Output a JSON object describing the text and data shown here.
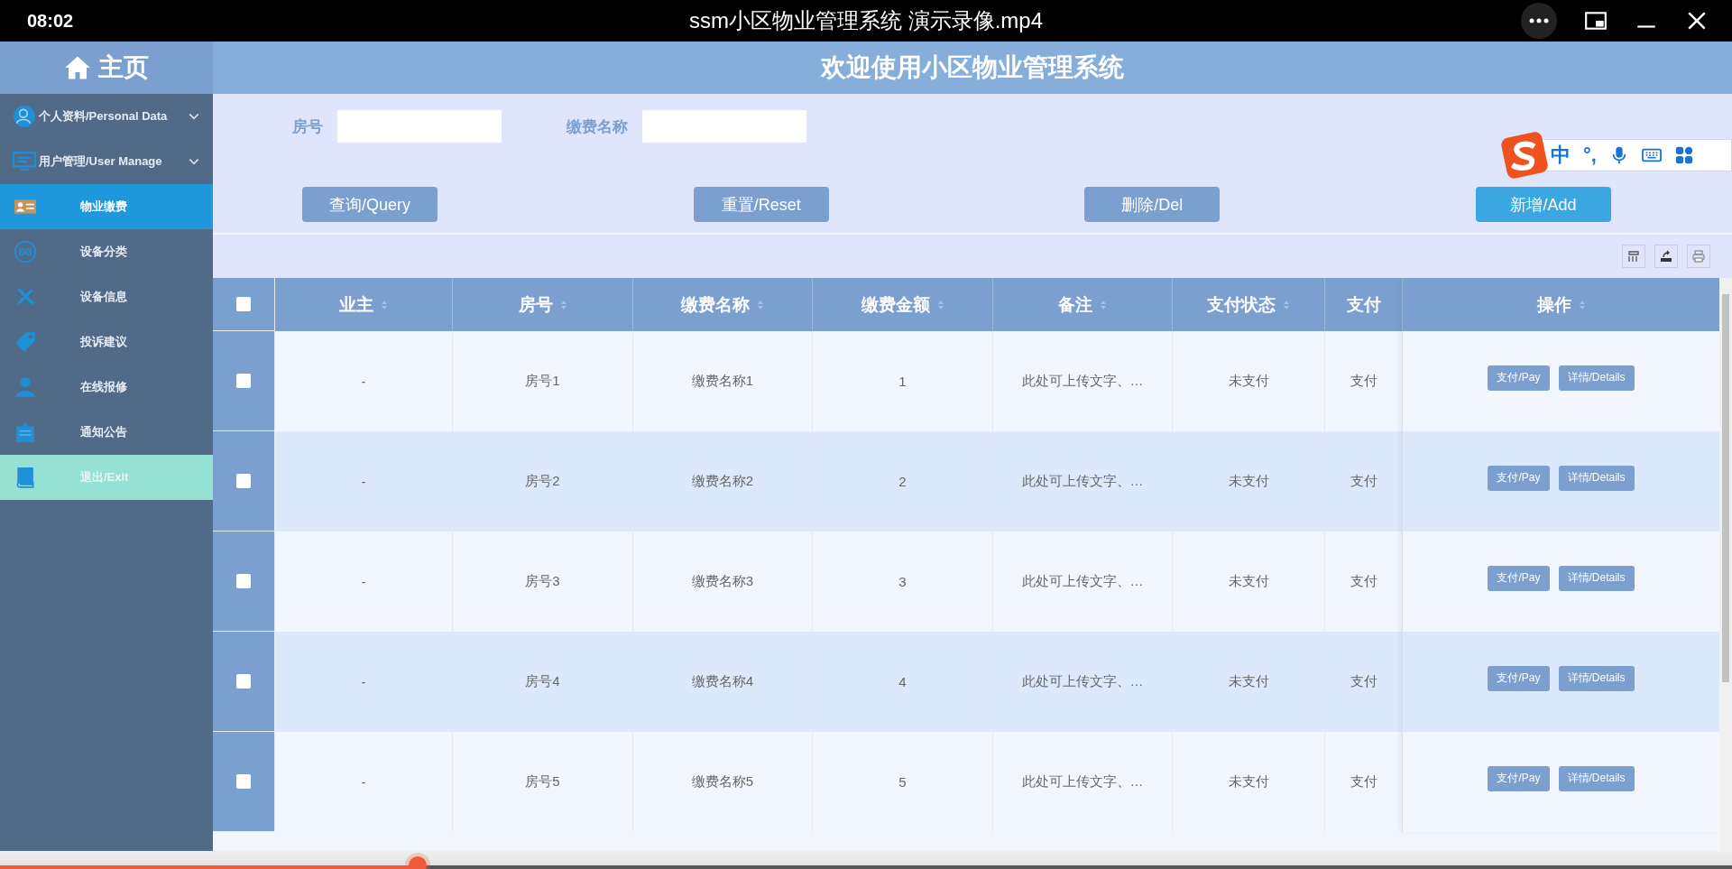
{
  "player": {
    "time": "08:02",
    "title": "ssm小区物业管理系统 演示录像.mp4",
    "progress": {
      "level": 0.241
    }
  },
  "sidebar": {
    "home": "主页",
    "items": [
      {
        "label": "个人资料/Personal Data",
        "kind": "group",
        "selected": false
      },
      {
        "label": "用户管理/User Manage",
        "kind": "group",
        "selected": false
      },
      {
        "label": "物业缴费",
        "kind": "link",
        "selected": true
      },
      {
        "label": "设备分类",
        "kind": "link",
        "selected": false
      },
      {
        "label": "设备信息",
        "kind": "link",
        "selected": false
      },
      {
        "label": "投诉建议",
        "kind": "link",
        "selected": false
      },
      {
        "label": "在线报修",
        "kind": "link",
        "selected": false
      },
      {
        "label": "通知公告",
        "kind": "link",
        "selected": false
      },
      {
        "label": "退出/Exit",
        "kind": "exit",
        "selected": false
      }
    ]
  },
  "header": {
    "title": "欢迎使用小区物业管理系统"
  },
  "search": [
    {
      "label": "房号"
    },
    {
      "label": "缴费名称"
    }
  ],
  "buttons": [
    {
      "label": "查询/Query",
      "kind": "normal"
    },
    {
      "label": "重置/Reset",
      "kind": "normal"
    },
    {
      "label": "删除/Del",
      "kind": "normal"
    },
    {
      "label": "新增/Add",
      "kind": "primary"
    }
  ],
  "ime": {
    "mode": "中",
    "punctuation": "°,"
  },
  "table": {
    "select_all": {
      "checked": false
    },
    "columns": [
      "业主",
      "房号",
      "缴费名称",
      "缴费金额",
      "备注",
      "支付状态",
      "支付",
      "操作"
    ],
    "rows": [
      {
        "checked": false,
        "cells": [
          "-",
          "房号1",
          "缴费名称1",
          "1",
          "此处可上传文字、…",
          "未支付",
          "支付"
        ],
        "actions": [
          "支付/Pay",
          "详情/Details"
        ]
      },
      {
        "checked": false,
        "cells": [
          "-",
          "房号2",
          "缴费名称2",
          "2",
          "此处可上传文字、…",
          "未支付",
          "支付"
        ],
        "actions": [
          "支付/Pay",
          "详情/Details"
        ]
      },
      {
        "checked": false,
        "cells": [
          "-",
          "房号3",
          "缴费名称3",
          "3",
          "此处可上传文字、…",
          "未支付",
          "支付"
        ],
        "actions": [
          "支付/Pay",
          "详情/Details"
        ]
      },
      {
        "checked": false,
        "cells": [
          "-",
          "房号4",
          "缴费名称4",
          "4",
          "此处可上传文字、…",
          "未支付",
          "支付"
        ],
        "actions": [
          "支付/Pay",
          "详情/Details"
        ]
      },
      {
        "checked": false,
        "cells": [
          "-",
          "房号5",
          "缴费名称5",
          "5",
          "此处可上传文字、…",
          "未支付",
          "支付"
        ],
        "actions": [
          "支付/Pay",
          "详情/Details"
        ]
      }
    ]
  }
}
